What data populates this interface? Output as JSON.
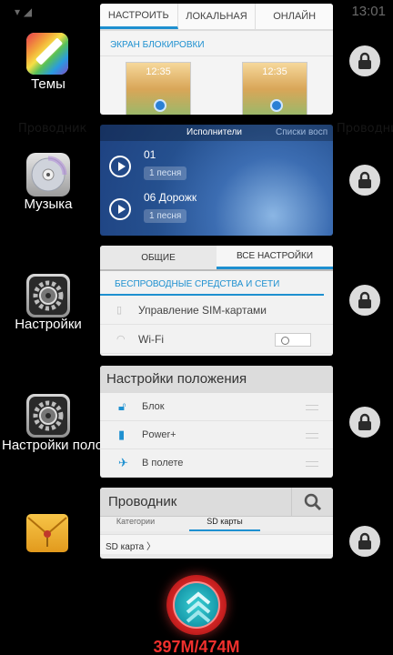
{
  "status_bar": {
    "time": "13:01"
  },
  "apps": [
    {
      "label": "Темы",
      "icon": "themes-palette-icon"
    },
    {
      "label": "Музыка",
      "icon": "music-disc-icon"
    },
    {
      "label": "Настройки",
      "icon": "settings-gear-icon"
    },
    {
      "label": "Настройки поло",
      "icon": "settings-gear-icon"
    },
    {
      "label": "",
      "icon": "file-manager-envelope-icon"
    }
  ],
  "background_ghost_text": {
    "left": "Проводник",
    "right": "Проводник"
  },
  "themes_card": {
    "tabs": [
      "НАСТРОИТЬ",
      "ЛОКАЛЬНАЯ",
      "ОНЛАЙН"
    ],
    "section": "ЭКРАН БЛОКИРОВКИ",
    "thumb_time": "12:35"
  },
  "music_card": {
    "header_active": "Исполнители",
    "header_other": "Списки восп",
    "tracks": [
      {
        "name": "01",
        "count": "1 песня"
      },
      {
        "name": "06 Дорожк",
        "count": "1 песня"
      }
    ]
  },
  "settings_card": {
    "tabs": [
      "ОБЩИЕ",
      "ВСЕ НАСТРОЙКИ"
    ],
    "section": "БЕСПРОВОДНЫЕ СРЕДСТВА И СЕТИ",
    "rows": [
      "Управление SIM-картами",
      "Wi-Fi"
    ]
  },
  "position_card": {
    "title": "Настройки положения",
    "rows": [
      "Блок",
      "Power+",
      "В полете"
    ]
  },
  "files_card": {
    "title": "Проводник",
    "tabs": [
      "Категории",
      "SD карты"
    ],
    "path": "SD карта 〉"
  },
  "memory": {
    "text": "397M/474M"
  },
  "colors": {
    "accent": "#1e90d0",
    "memory_red": "#f0302d",
    "card_bg": "#f2f2f2"
  }
}
